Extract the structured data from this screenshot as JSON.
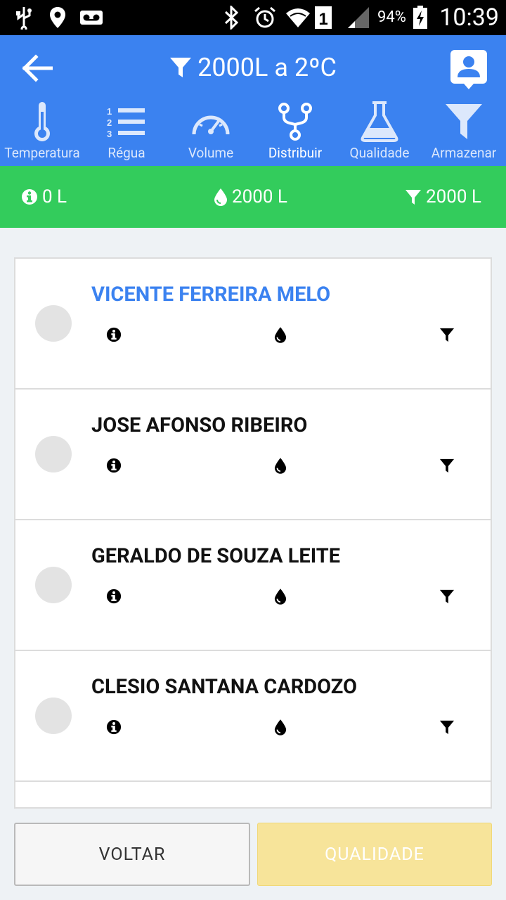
{
  "status": {
    "battery": "94%",
    "time": "10:39",
    "sim": "1"
  },
  "header": {
    "title": "2000L a 2ºC"
  },
  "tabs": [
    {
      "label": "Temperatura",
      "icon": "thermometer-icon"
    },
    {
      "label": "Régua",
      "icon": "ruler-list-icon"
    },
    {
      "label": "Volume",
      "icon": "gauge-icon"
    },
    {
      "label": "Distribuir",
      "icon": "distribute-icon"
    },
    {
      "label": "Qualidade",
      "icon": "flask-icon"
    },
    {
      "label": "Armazenar",
      "icon": "filter-icon"
    }
  ],
  "summary": {
    "info": "0 L",
    "volume": "2000 L",
    "stored": "2000 L"
  },
  "producers": [
    {
      "name": "VICENTE FERREIRA MELO",
      "selected": true
    },
    {
      "name": "JOSE AFONSO RIBEIRO",
      "selected": false
    },
    {
      "name": "GERALDO DE SOUZA LEITE",
      "selected": false
    },
    {
      "name": "CLESIO SANTANA CARDOZO",
      "selected": false
    }
  ],
  "footer": {
    "back_label": "VOLTAR",
    "next_label": "QUALIDADE"
  },
  "colors": {
    "appbar": "#3b82f0",
    "summary": "#33cc5c",
    "selected_name": "#3b82f0",
    "disabled_button": "#f7e49a"
  }
}
